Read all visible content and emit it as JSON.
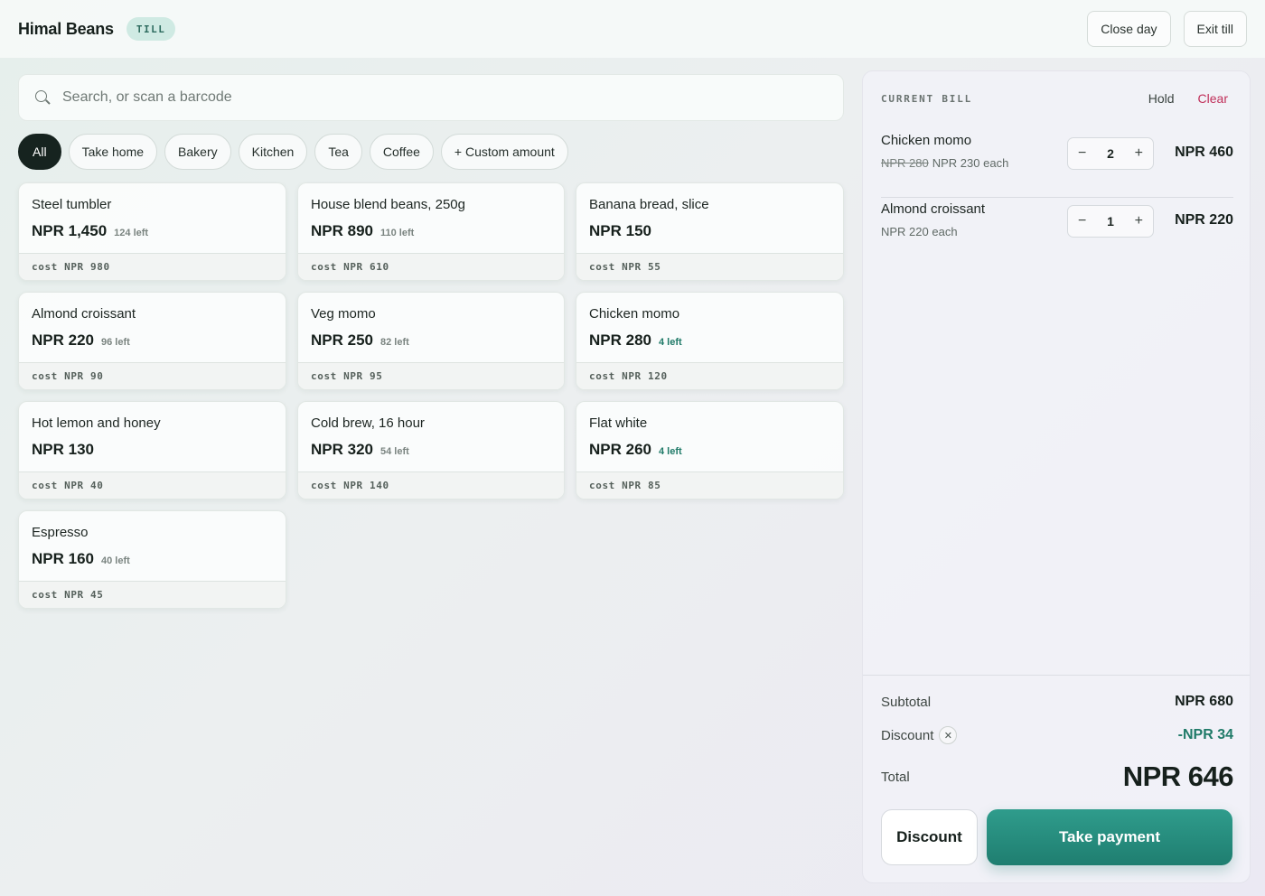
{
  "header": {
    "brand": "Himal Beans",
    "badge": "TILL",
    "close_day": "Close day",
    "exit_till": "Exit till"
  },
  "search": {
    "placeholder": "Search, or scan a barcode"
  },
  "filters": [
    "All",
    "Take home",
    "Bakery",
    "Kitchen",
    "Tea",
    "Coffee",
    "+ Custom amount"
  ],
  "active_filter": "All",
  "products": [
    {
      "name": "Steel tumbler",
      "price": "NPR 1,450",
      "stock": "124 left",
      "cost": "cost NPR 980"
    },
    {
      "name": "House blend beans, 250g",
      "price": "NPR 890",
      "stock": "110 left",
      "cost": "cost NPR 610"
    },
    {
      "name": "Banana bread, slice",
      "price": "NPR 150",
      "stock": "",
      "cost": "cost NPR 55"
    },
    {
      "name": "Almond croissant",
      "price": "NPR 220",
      "stock": "96 left",
      "cost": "cost NPR 90"
    },
    {
      "name": "Veg momo",
      "price": "NPR 250",
      "stock": "82 left",
      "cost": "cost NPR 95"
    },
    {
      "name": "Chicken momo",
      "price": "NPR 280",
      "stock": "4 left",
      "cost": "cost NPR 120"
    },
    {
      "name": "Hot lemon and honey",
      "price": "NPR 130",
      "stock": "",
      "cost": "cost NPR 40"
    },
    {
      "name": "Cold brew, 16 hour",
      "price": "NPR 320",
      "stock": "54 left",
      "cost": "cost NPR 140"
    },
    {
      "name": "Flat white",
      "price": "NPR 260",
      "stock": "4 left",
      "cost": "cost NPR 85"
    },
    {
      "name": "Espresso",
      "price": "NPR 160",
      "stock": "40 left",
      "cost": "cost NPR 45"
    }
  ],
  "bill": {
    "title": "CURRENT BILL",
    "hold": "Hold",
    "clear": "Clear",
    "items": [
      {
        "name": "Chicken momo",
        "original_price": "NPR 280",
        "unit": "NPR 230 each",
        "qty": "2",
        "total": "NPR 460",
        "minus": "−",
        "plus": "+"
      },
      {
        "name": "Almond croissant",
        "original_price": "",
        "unit": "NPR 220 each",
        "qty": "1",
        "total": "NPR 220",
        "minus": "−",
        "plus": "+"
      }
    ],
    "subtotal_label": "Subtotal",
    "subtotal": "NPR 680",
    "discount_label": "Discount",
    "discount_remove": "✕",
    "discount": "-NPR 34",
    "total_label": "Total",
    "total": "NPR 646",
    "discount_button": "Discount",
    "pay_button": "Take payment"
  },
  "colors": {
    "accent": "#1f7e70",
    "danger": "#c0305a",
    "low_stock": "#1f7a68",
    "dark": "#16231f"
  }
}
